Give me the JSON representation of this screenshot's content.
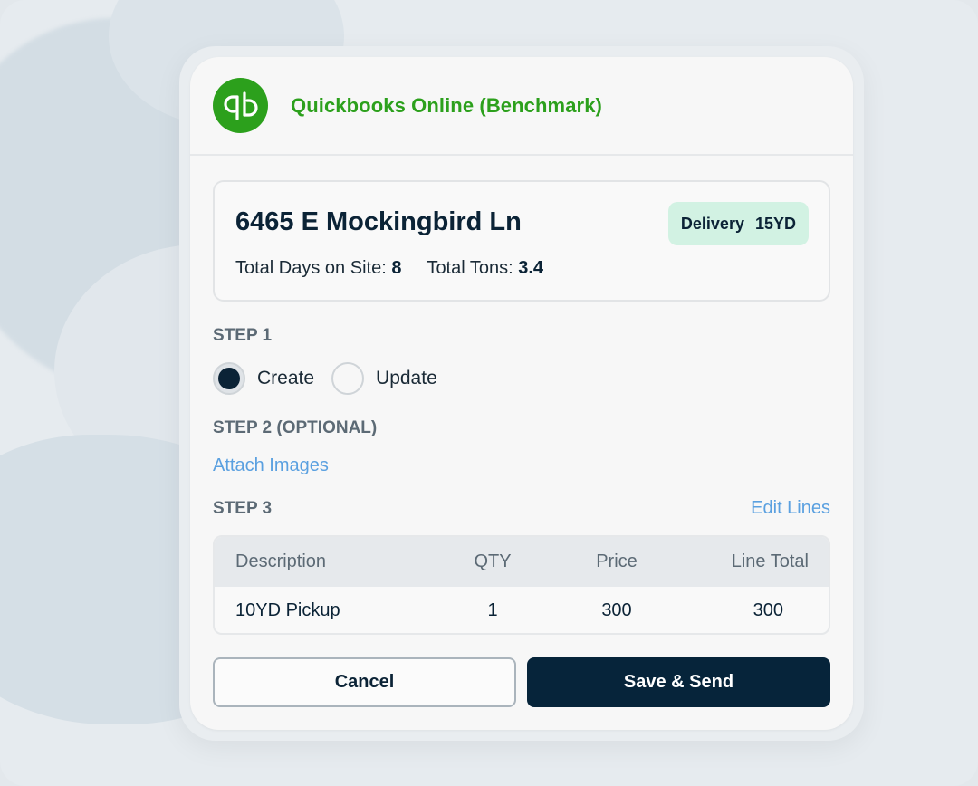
{
  "brand": {
    "name": "Quickbooks Online (Benchmark)",
    "logo_text": "qb",
    "color": "#2ca01c"
  },
  "site": {
    "address": "6465 E Mockingbird Ln",
    "badge_type": "Delivery",
    "badge_size": "15YD",
    "days_label": "Total Days on Site:",
    "days_value": "8",
    "tons_label": "Total Tons:",
    "tons_value": "3.4"
  },
  "step1": {
    "label": "STEP 1",
    "options": [
      {
        "label": "Create",
        "selected": true
      },
      {
        "label": "Update",
        "selected": false
      }
    ]
  },
  "step2": {
    "label": "STEP 2 (OPTIONAL)",
    "attach_link": "Attach Images"
  },
  "step3": {
    "label": "STEP 3",
    "edit_link": "Edit Lines",
    "columns": [
      "Description",
      "QTY",
      "Price",
      "Line Total"
    ],
    "rows": [
      {
        "description": "10YD Pickup",
        "qty": "1",
        "price": "300",
        "total": "300"
      }
    ]
  },
  "actions": {
    "cancel": "Cancel",
    "save": "Save & Send"
  },
  "colors": {
    "primary": "#06243a",
    "link": "#5aa0e0",
    "badge_bg": "#d2f2e3"
  }
}
